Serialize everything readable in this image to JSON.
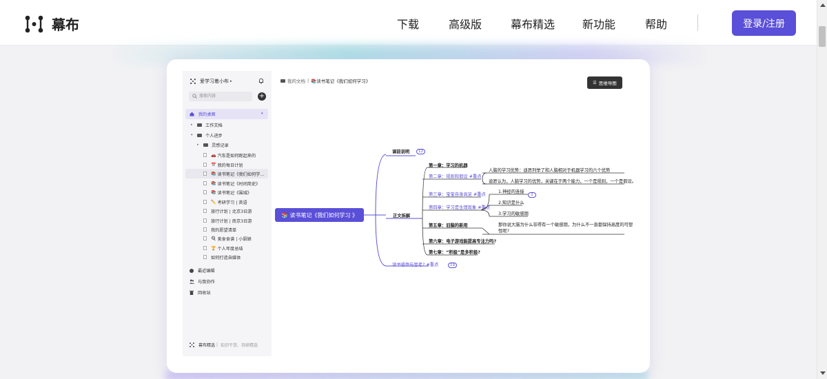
{
  "brand": {
    "name": "幕布"
  },
  "nav": {
    "items": [
      "下载",
      "高级版",
      "幕布精选",
      "新功能",
      "帮助"
    ],
    "login": "登录/注册"
  },
  "colors": {
    "accent": "#5a4fd8",
    "dark": "#333333"
  },
  "sidebar": {
    "workspace": "爱学习着小布",
    "search_placeholder": "搜索内容",
    "desk": "我的桌面",
    "tree": [
      {
        "label": "工作文档",
        "icon": "folder-icon",
        "arrow": "▸"
      },
      {
        "label": "个人进步",
        "icon": "folder-icon",
        "arrow": "▾"
      },
      {
        "label": "灵感记录",
        "icon": "folder-icon",
        "arrow": "▸"
      },
      {
        "label": "汽车是如何跑起来的",
        "icon": "doc-icon",
        "emoji": "🚗"
      },
      {
        "label": "我的每日计划",
        "icon": "doc-icon",
        "emoji": "📅"
      },
      {
        "label": "读书笔记《我们如何学...",
        "icon": "doc-icon",
        "emoji": "📚"
      },
      {
        "label": "读书笔记《时间简史》",
        "icon": "doc-icon",
        "emoji": "📚"
      },
      {
        "label": "读书笔记《围城》",
        "icon": "doc-icon",
        "emoji": "📚"
      },
      {
        "label": "考研学习 | 英语",
        "icon": "doc-icon",
        "emoji": "✏️"
      },
      {
        "label": "旅行计划 | 北京3日游",
        "icon": "doc-icon"
      },
      {
        "label": "旅行计划 | 南京3日游",
        "icon": "doc-icon"
      },
      {
        "label": "我的愿望清单",
        "icon": "doc-icon"
      },
      {
        "label": "美食食谱 | 小厨娘",
        "icon": "doc-icon",
        "emoji": "🍳"
      },
      {
        "label": "个人年度总结",
        "icon": "doc-icon",
        "emoji": "🏆"
      },
      {
        "label": "如何打造自媒体",
        "icon": "doc-icon"
      }
    ],
    "bottom": [
      "最近编辑",
      "与我协作",
      "回收站"
    ],
    "footer": {
      "main": "幕布精选",
      "sub": "知识干货、持续精选"
    }
  },
  "breadcrumb": {
    "root": "我的文档",
    "current": "📚读书笔记《我们如何学习》"
  },
  "mindmap_button": "思维导图",
  "mindmap": {
    "root": "📚 读书笔记《我们如何学习 》",
    "nodes": {
      "intro": "课前说明",
      "intro_badge": "12",
      "main": "正文拆解",
      "ch1": "第一章：学习的机器",
      "ch2": "第二章：规则和假设",
      "ch2_tag": "#重点",
      "ch2_a": "人脑的学习优势：迪昂列举了和人脑相对于机器学习的六个优势",
      "ch2_b": "迪昂认为，人脑学习的优势，关键在于两个能力，一个是规则，一个是假设。",
      "ch3": "第三章：宝宝自身具足",
      "ch3_tag": "#重点",
      "ch4": "第四章：学习是生理现象",
      "ch4_tag": "#重点",
      "ch4_a": "1.神经的连接",
      "ch4_badge": "2",
      "ch4_b": "2.知识是什么",
      "ch5": "第五章：旧脑的新用",
      "ch5_a": "3.学习的敏感期",
      "ch5_b": "那你说大脑为什么非得有一个敏感期，为什么不一直都保持高度的可塑",
      "ch5_c": "性呢?",
      "ch6": "第六章：电子游戏能提高专注力吗?",
      "ch7": "第七章：“积极”是多积极?",
      "reflect": "读书感悟与思考?",
      "reflect_tag": "#重点",
      "reflect_badge": "19"
    }
  }
}
